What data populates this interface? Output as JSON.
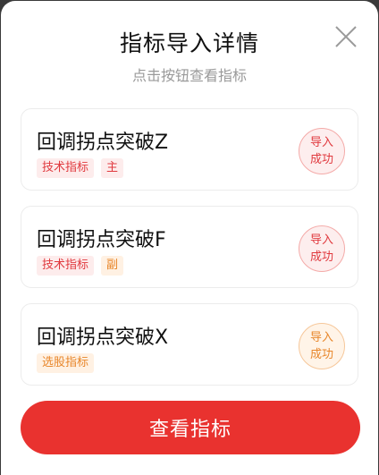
{
  "header": {
    "title": "指标导入详情",
    "subtitle": "点击按钮查看指标",
    "close_icon": "close-icon"
  },
  "cards": [
    {
      "name": "回调拐点突破Z",
      "tags": [
        {
          "label": "技术指标",
          "tone": "red"
        },
        {
          "label": "主",
          "tone": "red"
        }
      ],
      "status": {
        "line1": "导入",
        "line2": "成功",
        "tone": "red"
      }
    },
    {
      "name": "回调拐点突破F",
      "tags": [
        {
          "label": "技术指标",
          "tone": "red"
        },
        {
          "label": "副",
          "tone": "orange"
        }
      ],
      "status": {
        "line1": "导入",
        "line2": "成功",
        "tone": "red"
      }
    },
    {
      "name": "回调拐点突破X",
      "tags": [
        {
          "label": "选股指标",
          "tone": "orange"
        }
      ],
      "status": {
        "line1": "导入",
        "line2": "成功",
        "tone": "orange"
      }
    }
  ],
  "cta_label": "查看指标",
  "colors": {
    "accent": "#e9322f",
    "tag_red": "#e0393e",
    "tag_orange": "#e8862a"
  }
}
